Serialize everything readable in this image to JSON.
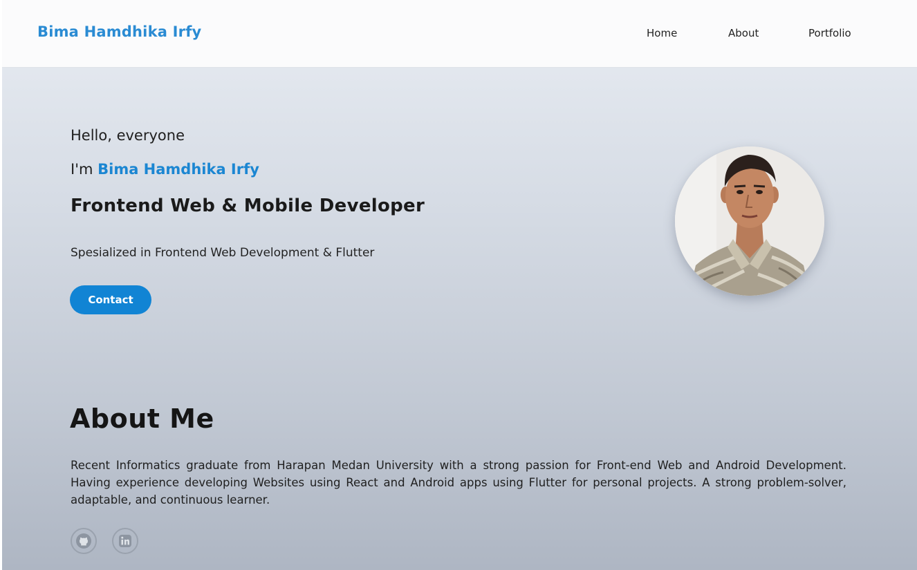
{
  "navbar": {
    "brand": "Bima Hamdhika Irfy",
    "links": [
      "Home",
      "About",
      "Portfolio"
    ]
  },
  "hero": {
    "greeting": "Hello, everyone",
    "intro_prefix": "I'm ",
    "name": "Bima Hamdhika Irfy",
    "role": "Frontend Web & Mobile Developer",
    "specialty": "Spesialized in Frontend Web Development & Flutter",
    "contact_label": "Contact"
  },
  "about": {
    "title": "About Me",
    "text": "Recent Informatics graduate from Harapan Medan University with a strong passion for Front-end Web and Android Development. Having experience developing Websites using React and Android apps using Flutter for personal projects. A strong problem-solver, adaptable, and continuous learner.",
    "social": [
      {
        "icon": "github-icon"
      },
      {
        "icon": "linkedin-icon"
      }
    ]
  },
  "colors": {
    "accent": "#1b86d2",
    "button": "#1184d4",
    "nav_bg": "#fbfbfc"
  }
}
